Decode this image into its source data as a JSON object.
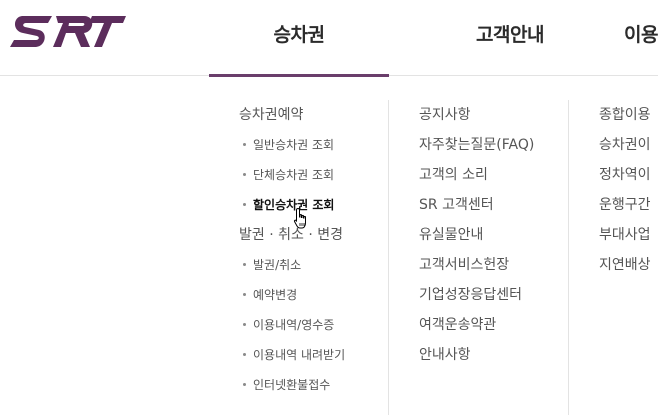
{
  "logo": {
    "text": "SRT",
    "color": "#5c2d5c"
  },
  "colors": {
    "accent": "#6a3e6b",
    "divider": "#e3e3e3",
    "text": "#555555"
  },
  "gnb": [
    {
      "label": "승차권",
      "active": true
    },
    {
      "label": "고객안내",
      "active": false
    },
    {
      "label": "이용",
      "active": false
    }
  ],
  "menu": {
    "col1": {
      "items": [
        {
          "label": "승차권예약",
          "type": "main"
        },
        {
          "label": "일반승차권 조회",
          "type": "sub"
        },
        {
          "label": "단체승차권 조회",
          "type": "sub"
        },
        {
          "label": "할인승차권 조회",
          "type": "sub",
          "hover": true
        },
        {
          "label": "발권 · 취소 · 변경",
          "type": "main"
        },
        {
          "label": "발권/취소",
          "type": "sub"
        },
        {
          "label": "예약변경",
          "type": "sub"
        },
        {
          "label": "이용내역/영수증",
          "type": "sub"
        },
        {
          "label": "이용내역 내려받기",
          "type": "sub"
        },
        {
          "label": "인터넷환불접수",
          "type": "sub"
        }
      ]
    },
    "col2": {
      "items": [
        "공지사항",
        "자주찾는질문(FAQ)",
        "고객의 소리",
        "SR 고객센터",
        "유실물안내",
        "고객서비스헌장",
        "기업성장응답센터",
        "여객운송약관",
        "안내사항"
      ]
    },
    "col3": {
      "items": [
        "종합이용",
        "승차권이",
        "정차역이",
        "운행구간",
        "부대사업",
        "지연배상"
      ]
    }
  },
  "cursor_icon": "hand-pointer-icon"
}
